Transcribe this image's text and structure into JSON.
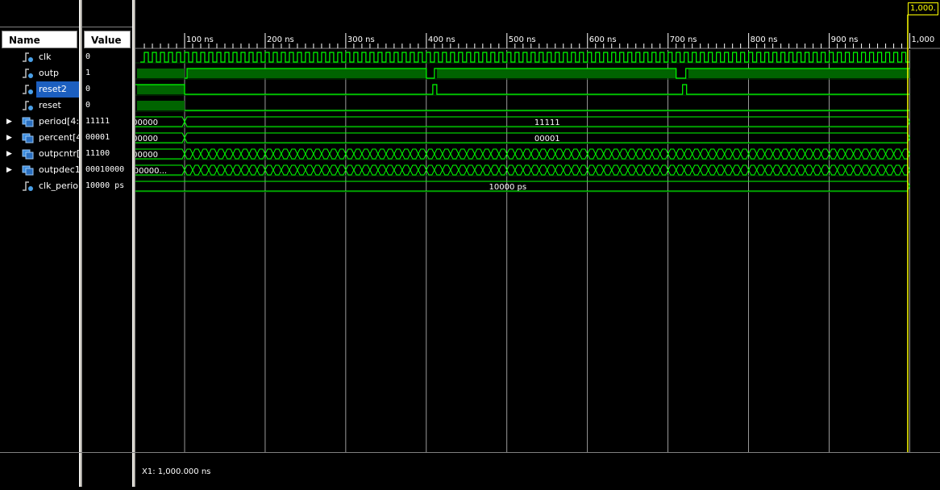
{
  "columns": {
    "name": "Name",
    "value": "Value"
  },
  "signals": [
    {
      "name": "clk",
      "value": "0",
      "icon": "logic-signal-icon",
      "expandable": false
    },
    {
      "name": "outp",
      "value": "1",
      "icon": "logic-signal-icon",
      "expandable": false
    },
    {
      "name": "reset2",
      "value": "0",
      "icon": "logic-signal-icon",
      "expandable": false,
      "selected": true
    },
    {
      "name": "reset",
      "value": "0",
      "icon": "logic-signal-icon",
      "expandable": false
    },
    {
      "name": "period[4:0",
      "value": "11111",
      "icon": "bus-signal-icon",
      "expandable": true
    },
    {
      "name": "percent[4",
      "value": "00001",
      "icon": "bus-signal-icon",
      "expandable": true
    },
    {
      "name": "outpcntr[",
      "value": "11100",
      "icon": "bus-signal-icon",
      "expandable": true
    },
    {
      "name": "outpdec1",
      "value": "00010000",
      "icon": "bus-signal-icon",
      "expandable": true
    },
    {
      "name": "clk_perio",
      "value": "10000 ps",
      "icon": "constant-signal-icon",
      "expandable": false
    }
  ],
  "timeline": {
    "ticks": [
      "100 ns",
      "200 ns",
      "300 ns",
      "400 ns",
      "500 ns",
      "600 ns",
      "700 ns",
      "800 ns",
      "900 ns",
      "1,000"
    ],
    "cursor_label": "1,000.",
    "cursor_readout": "X1: 1,000.000 ns"
  },
  "bus_labels": {
    "period_init": "00000",
    "period_main": "11111",
    "percent_init": "00000",
    "percent_main": "00001",
    "outpcntr_init": "00000",
    "outpdec_init": "0000000...",
    "clk_period": "10000 ps"
  },
  "colors": {
    "wave": "#00ff00",
    "cursor": "#ffff00",
    "fill": "#006400",
    "selection": "#1c5fc0"
  }
}
